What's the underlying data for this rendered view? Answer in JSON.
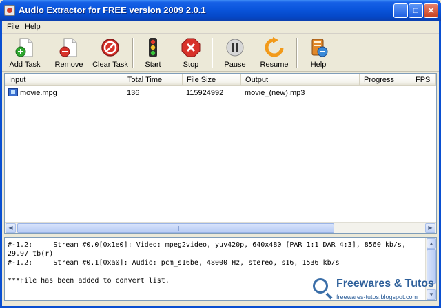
{
  "window": {
    "title": "Audio Extractor for FREE version 2009  2.0.1",
    "minimize_symbol": "_",
    "maximize_symbol": "□",
    "close_symbol": "✕"
  },
  "menu": {
    "file_label": "File",
    "help_label": "Help"
  },
  "toolbar": {
    "items": [
      {
        "label": "Add Task",
        "icon": "add-task-icon"
      },
      {
        "label": "Remove",
        "icon": "remove-icon"
      },
      {
        "label": "Clear Task",
        "icon": "clear-task-icon"
      },
      {
        "label": "Start",
        "icon": "traffic-light-icon"
      },
      {
        "label": "Stop",
        "icon": "stop-icon"
      },
      {
        "label": "Pause",
        "icon": "pause-icon"
      },
      {
        "label": "Resume",
        "icon": "resume-icon"
      },
      {
        "label": "Help",
        "icon": "help-icon"
      }
    ]
  },
  "task_list": {
    "columns": [
      "Input",
      "Total Time",
      "File Size",
      "Output",
      "Progress",
      "FPS"
    ],
    "rows": [
      {
        "input": "movie.mpg",
        "total_time": "136",
        "file_size": "115924992",
        "output": "movie_(new).mp3",
        "progress": "",
        "fps": ""
      }
    ]
  },
  "log": {
    "text": "#-1.2:     Stream #0.0[0x1e0]: Video: mpeg2video, yuv420p, 640x480 [PAR 1:1 DAR 4:3], 8560 kb/s, 29.97 tb(r)\n#-1.2:     Stream #0.1[0xa0]: Audio: pcm_s16be, 48000 Hz, stereo, s16, 1536 kb/s\n\n***File has been added to convert list."
  },
  "watermark": {
    "title": "Freewares & Tutos",
    "url": "freewares-tutos.blogspot.com"
  },
  "colors": {
    "titlebar": "#0a55dc",
    "client": "#ece9d8"
  }
}
